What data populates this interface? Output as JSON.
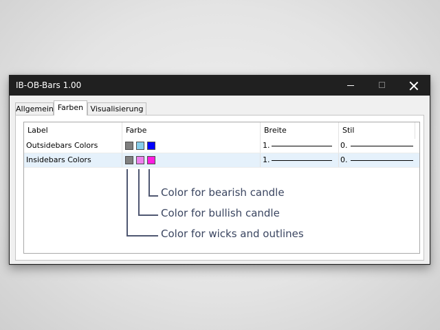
{
  "window": {
    "title": "IB-OB-Bars 1.00",
    "controls": {
      "minimize": "minimize-icon",
      "maximize": "maximize-icon",
      "close": "close-icon"
    }
  },
  "tabs": [
    {
      "label": "Allgemein",
      "active": false
    },
    {
      "label": "Farben",
      "active": true
    },
    {
      "label": "Visualisierung",
      "active": false
    }
  ],
  "table": {
    "headers": {
      "label": "Label",
      "color": "Farbe",
      "width": "Breite",
      "style": "Stil"
    },
    "rows": [
      {
        "label": "Outsidebars Colors",
        "colors": [
          "#808080",
          "#87ceeb",
          "#0000ff"
        ],
        "width": "1.",
        "style": "0.",
        "selected": false
      },
      {
        "label": "Insidebars Colors",
        "colors": [
          "#808080",
          "#ee82ee",
          "#ff1de0"
        ],
        "width": "1.",
        "style": "0.",
        "selected": true
      }
    ]
  },
  "annotations": {
    "bearish": "Color for bearish candle",
    "bullish": "Color for bullish candle",
    "wicks": "Color for wicks and outlines"
  },
  "colors": {
    "titlebar": "#202020",
    "selected_row": "#e5f1fb",
    "annotation_text": "#3a4560"
  }
}
